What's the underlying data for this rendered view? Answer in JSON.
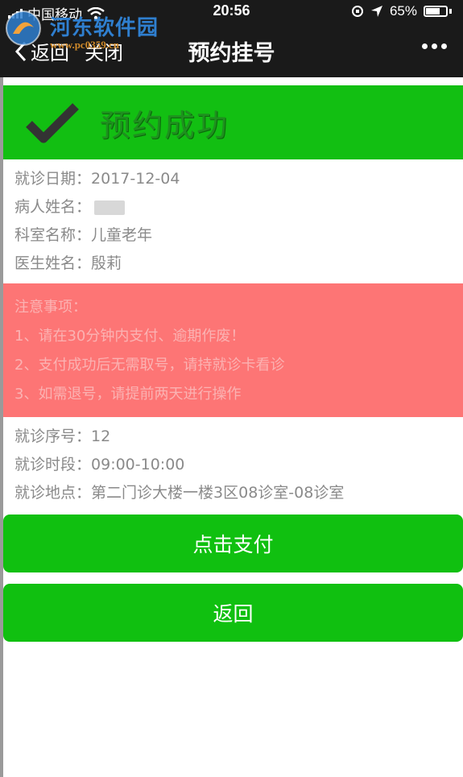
{
  "status_bar": {
    "carrier": "中国移动",
    "time": "20:56",
    "battery_percent": "65%"
  },
  "watermark": {
    "title": "河东软件园",
    "url": "www.pc0359.cn"
  },
  "nav": {
    "back_label": "返回",
    "close_label": "关闭",
    "title": "预约挂号"
  },
  "banner": {
    "text": "预约成功"
  },
  "visit_info": [
    {
      "label": "就诊日期：",
      "value": "2017-12-04"
    },
    {
      "label": "病人姓名：",
      "value": ""
    },
    {
      "label": "科室名称：",
      "value": "儿童老年"
    },
    {
      "label": "医生姓名：",
      "value": "殷莉"
    }
  ],
  "notice": {
    "title": "注意事项：",
    "items": [
      "1、请在30分钟内支付、逾期作废！",
      "2、支付成功后无需取号，请持就诊卡看诊",
      "3、如需退号，请提前两天进行操作"
    ]
  },
  "queue_info": [
    {
      "label": "就诊序号：",
      "value": "12"
    },
    {
      "label": "就诊时段：",
      "value": "09:00-10:00"
    },
    {
      "label": "就诊地点：",
      "value": "第二门诊大楼一楼3区08诊室-08诊室"
    }
  ],
  "buttons": {
    "pay_label": "点击支付",
    "back_label": "返回"
  },
  "colors": {
    "accent_green": "#10c010",
    "notice_red": "#fd7575",
    "navbar": "#1a1a1a"
  }
}
